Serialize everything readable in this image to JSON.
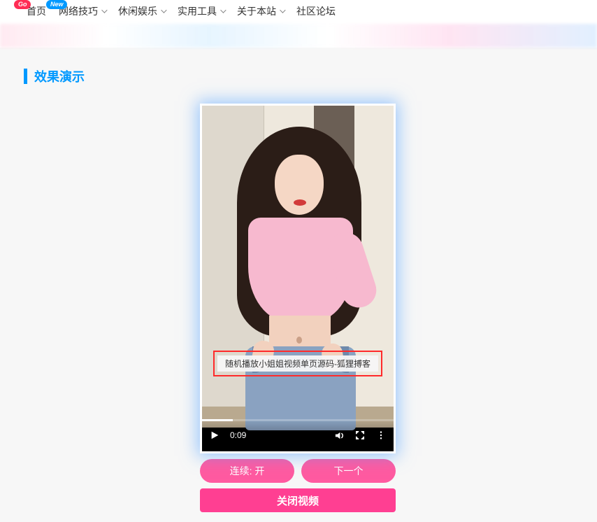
{
  "nav": {
    "items": [
      {
        "label": "首页",
        "badge": "Go",
        "badgeClass": "go",
        "dropdown": false
      },
      {
        "label": "网络技巧",
        "badge": "New",
        "badgeClass": "new",
        "dropdown": true
      },
      {
        "label": "休闲娱乐",
        "dropdown": true
      },
      {
        "label": "实用工具",
        "dropdown": true
      },
      {
        "label": "关于本站",
        "dropdown": true
      },
      {
        "label": "社区论坛",
        "dropdown": false
      }
    ]
  },
  "heading": "效果演示",
  "video": {
    "caption": "随机播放小姐姐视频单页源码-狐狸搏客",
    "time": "0:09"
  },
  "buttons": {
    "continuous": "连续: 开",
    "next": "下一个",
    "close": "关闭视频"
  }
}
